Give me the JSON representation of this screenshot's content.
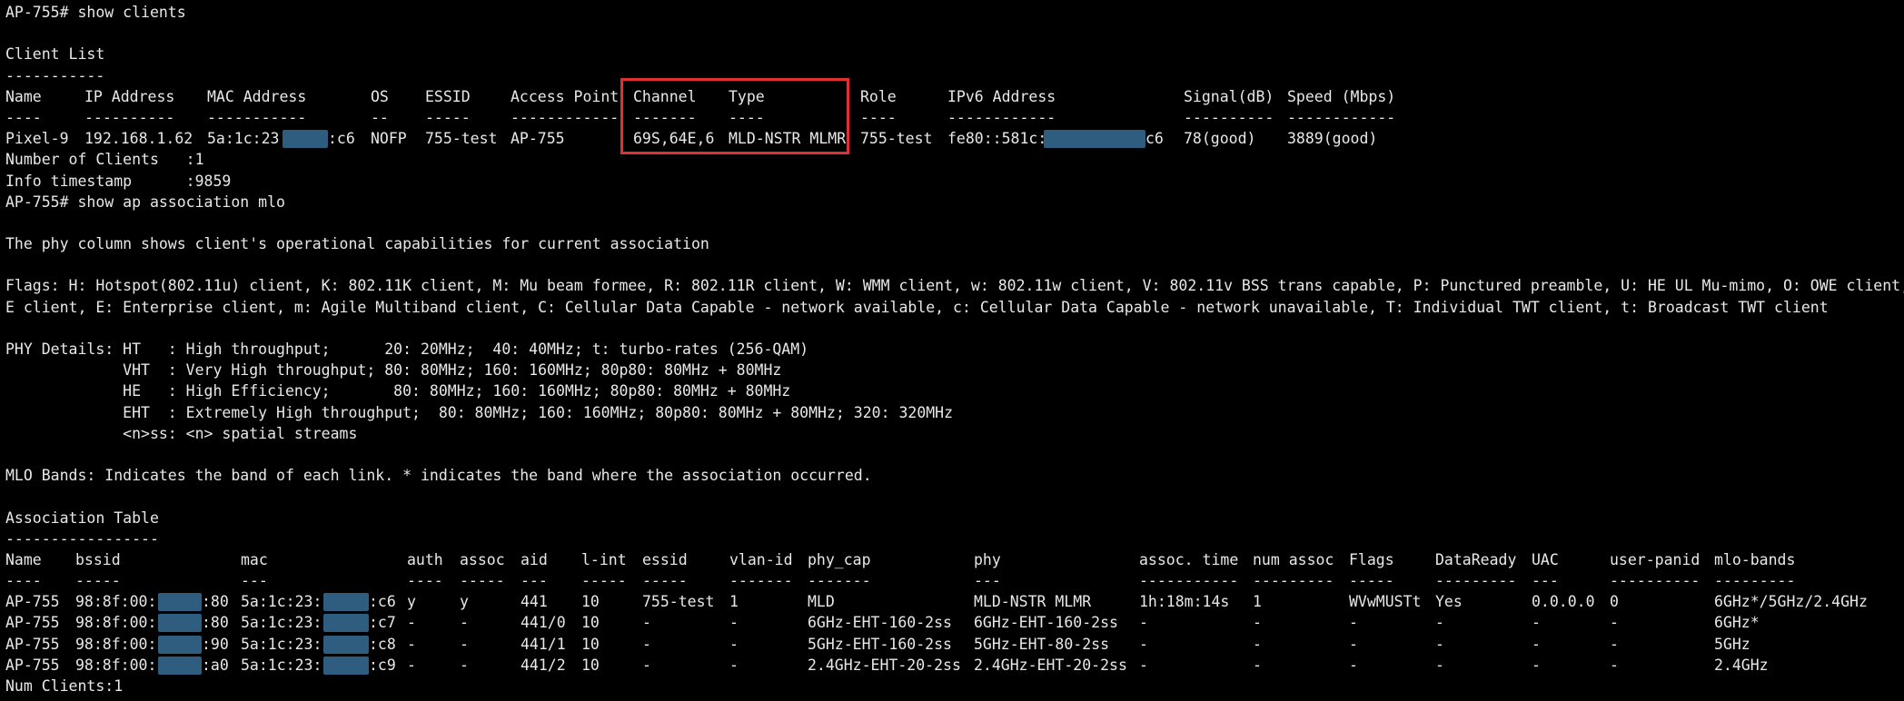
{
  "prompt1": {
    "text": "AP-755# show clients"
  },
  "client_list": {
    "title": "Client List",
    "title_underline": "-----------",
    "headers": [
      "Name",
      "IP Address",
      "MAC Address",
      "OS",
      "ESSID",
      "Access Point",
      "Channel",
      "Type",
      "Role",
      "IPv6 Address",
      "Signal(dB)",
      "Speed (Mbps)"
    ],
    "underlines": [
      "----",
      "----------",
      "-----------",
      "--",
      "-----",
      "------------",
      "-------",
      "----",
      "----",
      "------------",
      "----------",
      "------------"
    ],
    "row": {
      "name": "Pixel-9",
      "ip": "192.168.1.62",
      "mac_prefix": "5a:1c:23",
      "mac_suffix": ":c6",
      "os": "NOFP",
      "essid": "755-test",
      "ap": "AP-755",
      "channel": "69S,64E,6",
      "type": "MLD-NSTR MLMR",
      "role": "755-test",
      "ipv6_prefix": "fe80::581c:",
      "ipv6_suffix": "c6",
      "signal": "78(good)",
      "speed": "3889(good)"
    },
    "count_line": "Number of Clients   :1",
    "timestamp_line": "Info timestamp      :9859"
  },
  "prompt2": {
    "text": "AP-755# show ap association mlo"
  },
  "phy_note": "The phy column shows client's operational capabilities for current association",
  "flags_lines": [
    "Flags: H: Hotspot(802.11u) client, K: 802.11K client, M: Mu beam formee, R: 802.11R client, W: WMM client, w: 802.11w client, V: 802.11v BSS trans capable, P: Punctured preamble, U: HE UL Mu-mimo, O: OWE client, S: SA",
    "E client, E: Enterprise client, m: Agile Multiband client, C: Cellular Data Capable - network available, c: Cellular Data Capable - network unavailable, T: Individual TWT client, t: Broadcast TWT client"
  ],
  "phy_details": [
    "PHY Details: HT   : High throughput;      20: 20MHz;  40: 40MHz; t: turbo-rates (256-QAM)",
    "             VHT  : Very High throughput; 80: 80MHz; 160: 160MHz; 80p80: 80MHz + 80MHz",
    "             HE   : High Efficiency;       80: 80MHz; 160: 160MHz; 80p80: 80MHz + 80MHz",
    "             EHT  : Extremely High throughput;  80: 80MHz; 160: 160MHz; 80p80: 80MHz + 80MHz; 320: 320MHz",
    "             <n>ss: <n> spatial streams"
  ],
  "mlo_note": "MLO Bands: Indicates the band of each link. * indicates the band where the association occurred.",
  "assoc_table": {
    "title": "Association Table",
    "title_underline": "-----------------",
    "headers": [
      "Name",
      "bssid",
      "mac",
      "auth",
      "assoc",
      "aid",
      "l-int",
      "essid",
      "vlan-id",
      "phy_cap",
      "phy",
      "assoc. time",
      "num assoc",
      "Flags",
      "DataReady",
      "UAC",
      "user-panid",
      "mlo-bands"
    ],
    "underlines": [
      "----",
      "-----",
      "---",
      "----",
      "-----",
      "---",
      "-----",
      "-----",
      "-------",
      "-------",
      "---",
      "-----------",
      "---------",
      "-----",
      "---------",
      "---",
      "----------",
      "---------"
    ],
    "rows": [
      {
        "name": "AP-755",
        "bssid_prefix": "98:8f:00:",
        "bssid_suffix": ":80",
        "mac_prefix": "5a:1c:23:",
        "mac_suffix": ":c6",
        "auth": "y",
        "assoc": "y",
        "aid": "441",
        "lint": "10",
        "essid": "755-test",
        "vlan": "1",
        "phy_cap": "MLD",
        "phy": "MLD-NSTR MLMR",
        "assoc_time": "1h:18m:14s",
        "num_assoc": "1",
        "flags": "WVwMUSTt",
        "dataready": "Yes",
        "uac": "0.0.0.0",
        "panid": "0",
        "mlo": "6GHz*/5GHz/2.4GHz"
      },
      {
        "name": "AP-755",
        "bssid_prefix": "98:8f:00:",
        "bssid_suffix": ":80",
        "mac_prefix": "5a:1c:23:",
        "mac_suffix": ":c7",
        "auth": "-",
        "assoc": "-",
        "aid": "441/0",
        "lint": "10",
        "essid": "-",
        "vlan": "-",
        "phy_cap": "6GHz-EHT-160-2ss",
        "phy": "6GHz-EHT-160-2ss",
        "assoc_time": "-",
        "num_assoc": "-",
        "flags": "-",
        "dataready": "-",
        "uac": "-",
        "panid": "-",
        "mlo": "6GHz*"
      },
      {
        "name": "AP-755",
        "bssid_prefix": "98:8f:00:",
        "bssid_suffix": ":90",
        "mac_prefix": "5a:1c:23:",
        "mac_suffix": ":c8",
        "auth": "-",
        "assoc": "-",
        "aid": "441/1",
        "lint": "10",
        "essid": "-",
        "vlan": "-",
        "phy_cap": "5GHz-EHT-160-2ss",
        "phy": "5GHz-EHT-80-2ss",
        "assoc_time": "-",
        "num_assoc": "-",
        "flags": "-",
        "dataready": "-",
        "uac": "-",
        "panid": "-",
        "mlo": "5GHz"
      },
      {
        "name": "AP-755",
        "bssid_prefix": "98:8f:00:",
        "bssid_suffix": ":a0",
        "mac_prefix": "5a:1c:23:",
        "mac_suffix": ":c9",
        "auth": "-",
        "assoc": "-",
        "aid": "441/2",
        "lint": "10",
        "essid": "-",
        "vlan": "-",
        "phy_cap": "2.4GHz-EHT-20-2ss",
        "phy": "2.4GHz-EHT-20-2ss",
        "assoc_time": "-",
        "num_assoc": "-",
        "flags": "-",
        "dataready": "-",
        "uac": "-",
        "panid": "-",
        "mlo": "2.4GHz"
      }
    ],
    "count_line": "Num Clients:1"
  },
  "colors": {
    "text": "#e8e8e8",
    "background": "#000000",
    "redaction": "#2e5d80",
    "highlight": "#e03030"
  }
}
